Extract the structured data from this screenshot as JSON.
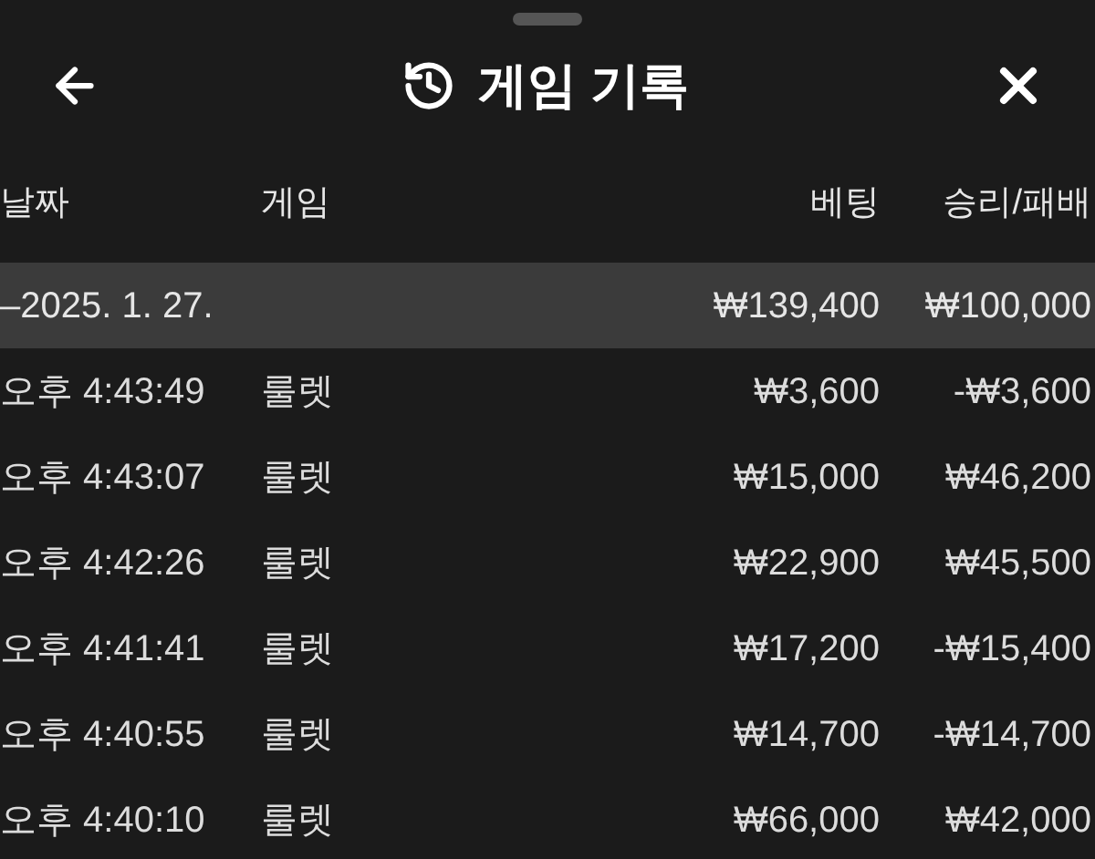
{
  "header": {
    "title": "게임 기록"
  },
  "table": {
    "columns": [
      "날짜",
      "게임",
      "베팅",
      "승리/패배"
    ],
    "group": {
      "date": "–2025. 1. 27.",
      "bet": "₩139,400",
      "result": "₩100,000"
    },
    "rows": [
      {
        "time": "오후 4:43:49",
        "game": "룰렛",
        "bet": "₩3,600",
        "result": "-₩3,600"
      },
      {
        "time": "오후 4:43:07",
        "game": "룰렛",
        "bet": "₩15,000",
        "result": "₩46,200"
      },
      {
        "time": "오후 4:42:26",
        "game": "룰렛",
        "bet": "₩22,900",
        "result": "₩45,500"
      },
      {
        "time": "오후 4:41:41",
        "game": "룰렛",
        "bet": "₩17,200",
        "result": "-₩15,400"
      },
      {
        "time": "오후 4:40:55",
        "game": "룰렛",
        "bet": "₩14,700",
        "result": "-₩14,700"
      },
      {
        "time": "오후 4:40:10",
        "game": "룰렛",
        "bet": "₩66,000",
        "result": "₩42,000"
      }
    ]
  }
}
